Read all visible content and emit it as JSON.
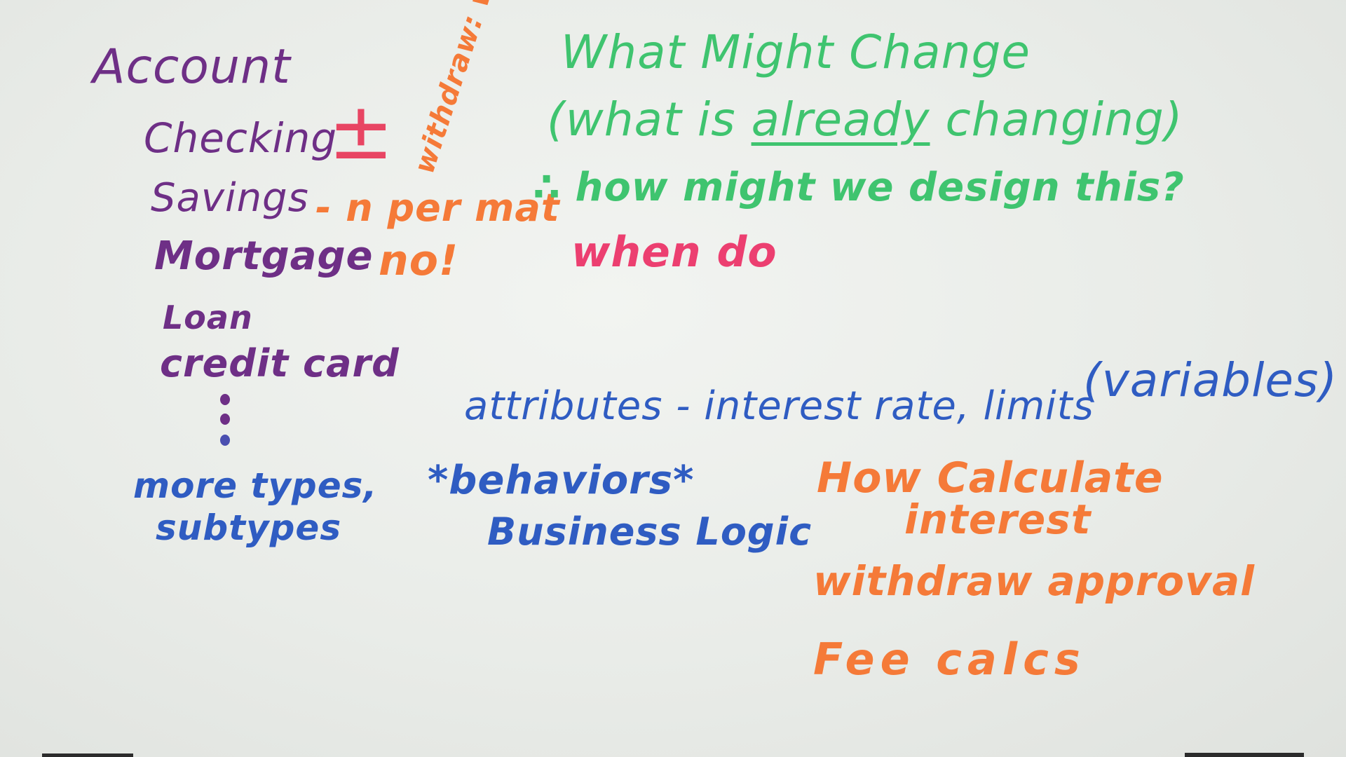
{
  "colors": {
    "purple": "#6e2f86",
    "green": "#3fc46f",
    "orange": "#f57a38",
    "pink": "#ec3f70",
    "blue": "#2f5cc2",
    "board": "#eceeeb"
  },
  "account_list": {
    "title": "Account",
    "items": [
      "Checking",
      "Savings",
      "Mortgage",
      "Loan",
      "credit card"
    ],
    "more": "more types,",
    "subtypes": "subtypes"
  },
  "annotations": {
    "checking_symbol": "±",
    "withdraw_vertical": "withdraw: w/own",
    "savings_note": "- n per mat",
    "mortgage_note": "no!",
    "when_do": "when do"
  },
  "green_notes": {
    "line1": "What Might Change",
    "line2_open": "(what is ",
    "line2_underlined": "already",
    "line2_close": " changing)",
    "line3": "∴ how might we design this?"
  },
  "blue_notes": {
    "attributes": "attributes - interest rate, limits",
    "variables": "(variables)",
    "behaviors": "*behaviors*",
    "business_logic": "Business Logic"
  },
  "orange_notes": {
    "how_calculate": "How Calculate",
    "interest": "interest",
    "withdraw_approval": "withdraw approval",
    "fee_calcs": "Fee calcs"
  }
}
